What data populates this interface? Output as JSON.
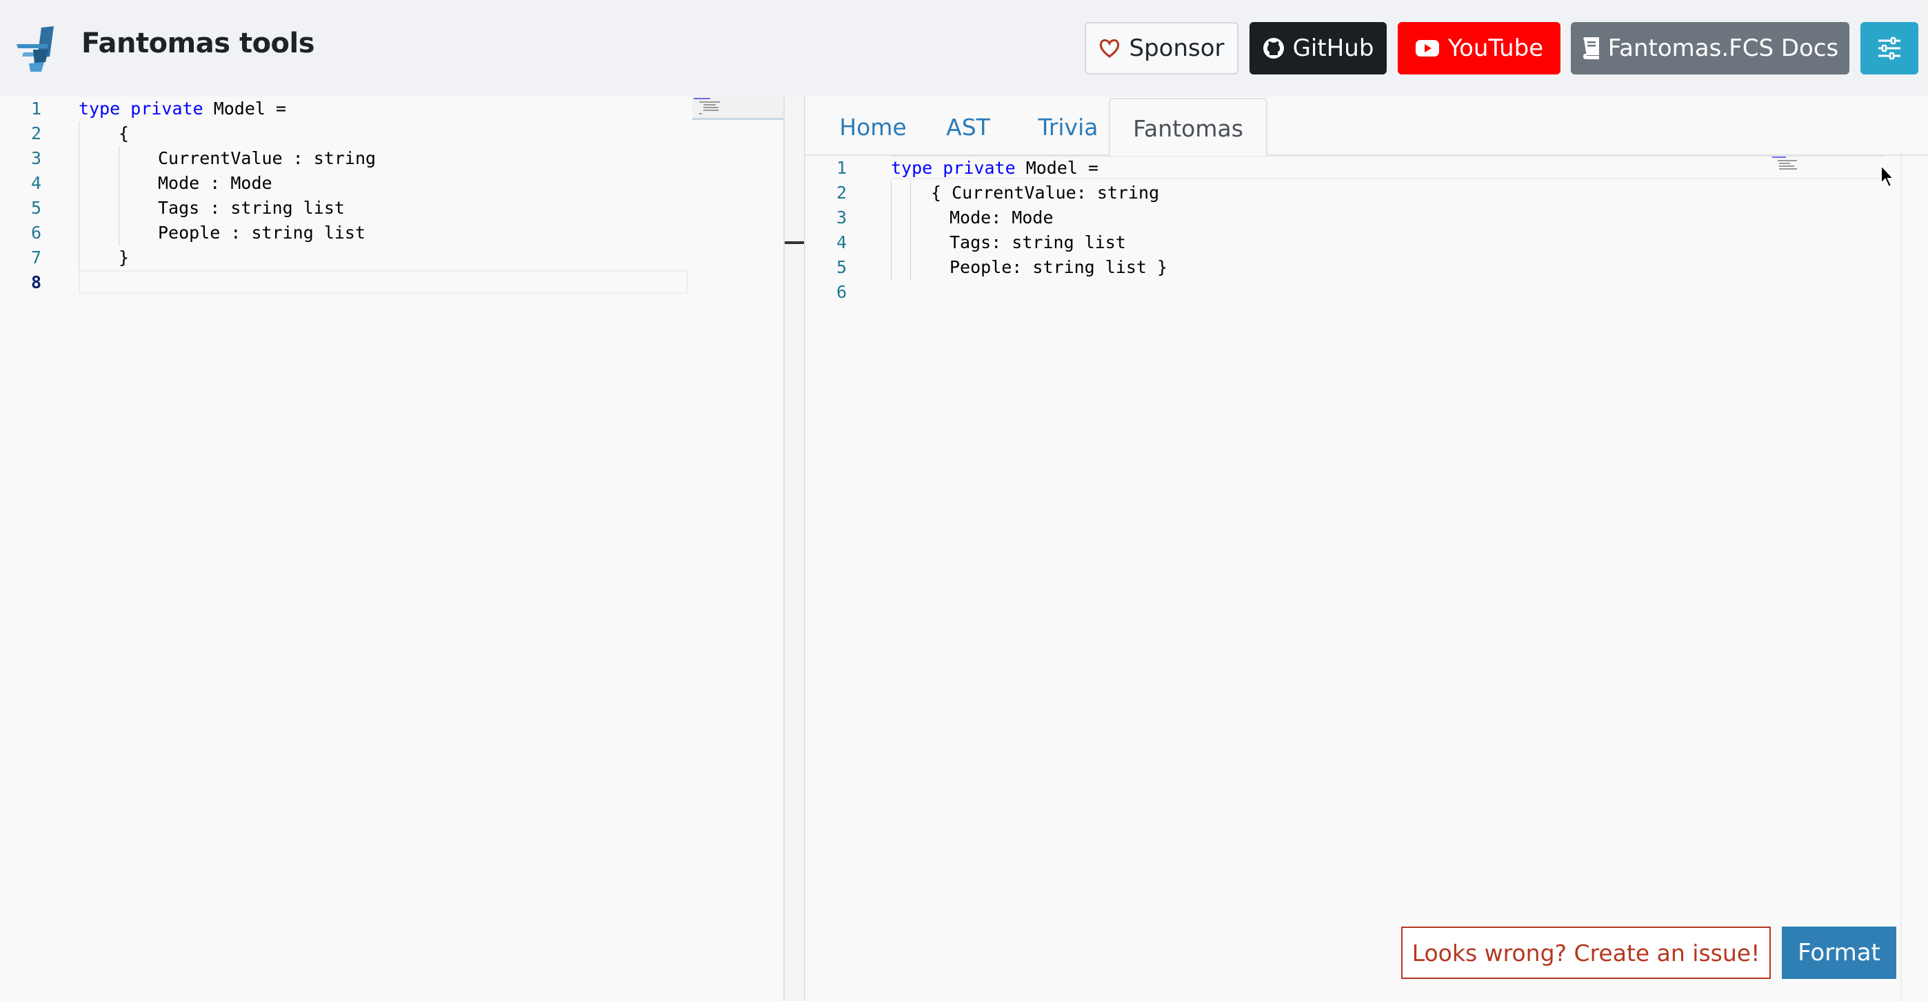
{
  "header": {
    "brand": "Fantomas tools",
    "buttons": {
      "sponsor": "Sponsor",
      "github": "GitHub",
      "youtube": "YouTube",
      "docs": "Fantomas.FCS Docs"
    }
  },
  "input_editor": {
    "line_numbers": [
      "1",
      "2",
      "3",
      "4",
      "5",
      "6",
      "7",
      "8"
    ],
    "active_line": "8",
    "lines": {
      "l1": {
        "kw1": "type",
        "kw2": "private",
        "rest": " Model ="
      },
      "l2": "{",
      "l3": "CurrentValue : string",
      "l4": "Mode : Mode",
      "l5": "Tags : string list",
      "l6": "People : string list",
      "l7": "}"
    }
  },
  "tabs": {
    "home": "Home",
    "ast": "AST",
    "trivia": "Trivia",
    "fantomas": "Fantomas",
    "active": "Fantomas"
  },
  "output_editor": {
    "line_numbers": [
      "1",
      "2",
      "3",
      "4",
      "5",
      "6"
    ],
    "lines": {
      "l1": {
        "kw1": "type",
        "kw2": "private",
        "rest": " Model ="
      },
      "l2": "{ CurrentValue: string",
      "l3": "Mode: Mode",
      "l4": "Tags: string list",
      "l5": "People: string list }"
    }
  },
  "actions": {
    "issue": "Looks wrong? Create an issue!",
    "format": "Format"
  },
  "colors": {
    "keyword": "#0000ff",
    "line_number": "#237893",
    "youtube": "#ff0000",
    "github": "#1b1f23",
    "settings": "#2ba6cb",
    "format": "#2f7fb5",
    "issue": "#b5381f"
  },
  "icons": [
    "fantomas-logo-icon",
    "heart-icon",
    "github-icon",
    "youtube-icon",
    "book-icon",
    "sliders-icon",
    "mouse-cursor-icon"
  ]
}
